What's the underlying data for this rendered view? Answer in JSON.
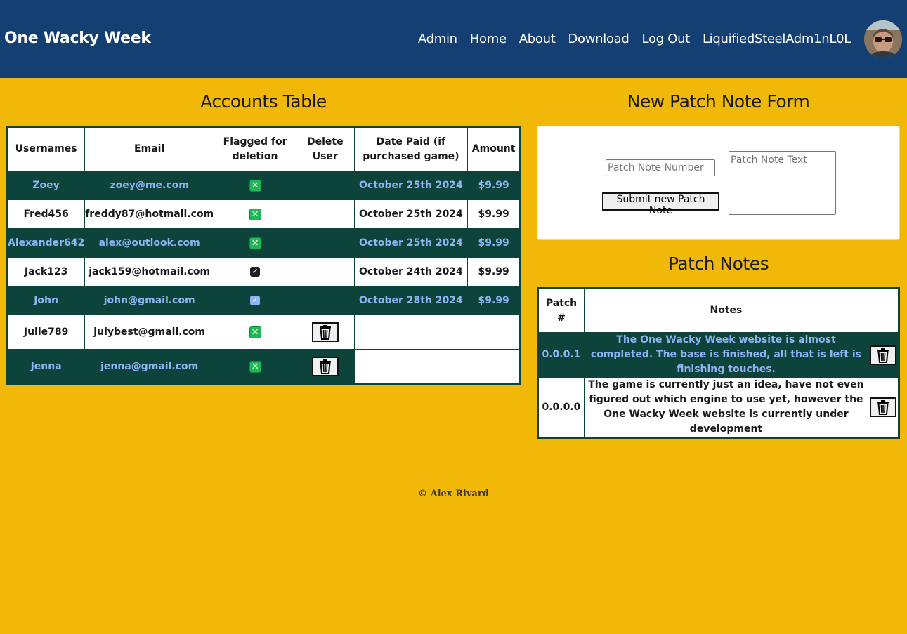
{
  "header": {
    "brand": "One Wacky Week",
    "nav": [
      "Admin",
      "Home",
      "About",
      "Download",
      "Log Out",
      "LiquifiedSteelAdm1nL0L"
    ],
    "bg_color": "#143f73"
  },
  "accounts": {
    "title": "Accounts Table",
    "headers": [
      "Usernames",
      "Email",
      "Flagged for deletion",
      "Delete User",
      "Date Paid (if purchased game)",
      "Amount"
    ],
    "rows": [
      {
        "username": "Zoey",
        "email": "zoey@me.com",
        "flag": "green-x",
        "date": "October 25th 2024",
        "amount": "$9.99"
      },
      {
        "username": "Fred456",
        "email": "freddy87@hotmail.com",
        "flag": "green-x",
        "date": "October 25th 2024",
        "amount": "$9.99"
      },
      {
        "username": "Alexander642",
        "email": "alex@outlook.com",
        "flag": "green-x",
        "date": "October 25th 2024",
        "amount": "$9.99"
      },
      {
        "username": "Jack123",
        "email": "jack159@hotmail.com",
        "flag": "checked",
        "date": "October 24th 2024",
        "amount": "$9.99"
      },
      {
        "username": "John",
        "email": "john@gmail.com",
        "flag": "checked",
        "date": "October 28th 2024",
        "amount": "$9.99"
      },
      {
        "username": "Julie789",
        "email": "julybest@gmail.com",
        "flag": "green-x",
        "date": "",
        "amount": ""
      },
      {
        "username": "Jenna",
        "email": "jenna@gmail.com",
        "flag": "green-x",
        "date": "",
        "amount": ""
      }
    ]
  },
  "patch_form": {
    "title": "New Patch Note Form",
    "number_placeholder": "Patch Note Number",
    "text_placeholder": "Patch Note Text",
    "submit_label": "Submit new Patch Note"
  },
  "patch_notes": {
    "title": "Patch Notes",
    "headers": [
      "Patch #",
      "Notes",
      ""
    ],
    "rows": [
      {
        "patch": "0.0.0.1",
        "notes": "The One Wacky Week website is almost completed. The base is finished, all that is left is finishing touches."
      },
      {
        "patch": "0.0.0.0",
        "notes": "The game is currently just an idea, have not even figured out which engine to use yet, however the One Wacky Week website is currently under development"
      }
    ]
  },
  "footer": {
    "text": "© Alex Rivard"
  },
  "colors": {
    "page_bg": "#f1b807",
    "table_dark_row": "#0c433a",
    "table_dark_text": "#8fb3f4",
    "checkbox_green": "#1db954"
  },
  "icons": {
    "trash": "trash-icon",
    "avatar": "user-avatar"
  }
}
